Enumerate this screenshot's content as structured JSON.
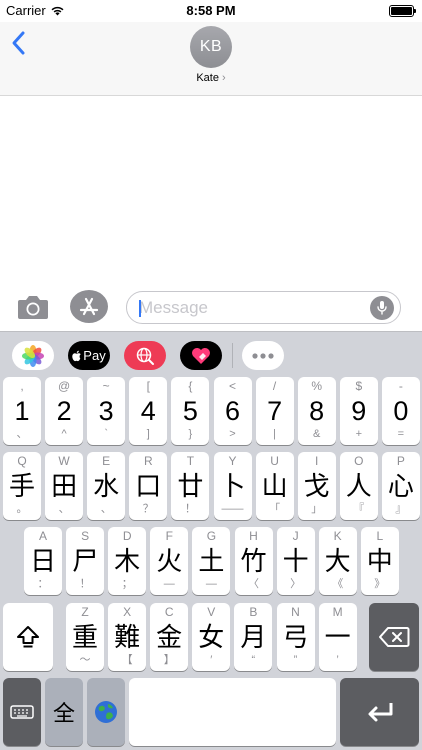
{
  "status": {
    "carrier": "Carrier",
    "time": "8:58 PM"
  },
  "header": {
    "avatar_initials": "KB",
    "contact_name": "Kate",
    "chevron": "›"
  },
  "compose": {
    "placeholder": "Message"
  },
  "app_drawer": {
    "apps": [
      {
        "name": "photos-app-icon"
      },
      {
        "name": "apple-pay-app-icon",
        "label": "Pay"
      },
      {
        "name": "web-search-app-icon"
      },
      {
        "name": "digital-touch-app-icon"
      },
      {
        "name": "more-apps-icon"
      }
    ]
  },
  "keyboard": {
    "row1": [
      {
        "main": "1",
        "top": ",",
        "bot": "、"
      },
      {
        "main": "2",
        "top": "@",
        "bot": "^"
      },
      {
        "main": "3",
        "top": "~",
        "bot": "`"
      },
      {
        "main": "4",
        "top": "[",
        "bot": "]"
      },
      {
        "main": "5",
        "top": "{",
        "bot": "}"
      },
      {
        "main": "6",
        "top": "<",
        "bot": ">"
      },
      {
        "main": "7",
        "top": "/",
        "bot": "|"
      },
      {
        "main": "8",
        "top": "%",
        "bot": "&"
      },
      {
        "main": "9",
        "top": "$",
        "bot": "+"
      },
      {
        "main": "0",
        "top": "-",
        "bot": "="
      }
    ],
    "row2": [
      {
        "main": "手",
        "top": "Q",
        "bot": "。"
      },
      {
        "main": "田",
        "top": "W",
        "bot": "、"
      },
      {
        "main": "水",
        "top": "E",
        "bot": "、"
      },
      {
        "main": "口",
        "top": "R",
        "bot": "？"
      },
      {
        "main": "廿",
        "top": "T",
        "bot": "！"
      },
      {
        "main": "卜",
        "top": "Y",
        "bot": "——"
      },
      {
        "main": "山",
        "top": "U",
        "bot": "「"
      },
      {
        "main": "戈",
        "top": "I",
        "bot": "」"
      },
      {
        "main": "人",
        "top": "O",
        "bot": "『"
      },
      {
        "main": "心",
        "top": "P",
        "bot": "』"
      }
    ],
    "row3": [
      {
        "main": "日",
        "top": "A",
        "bot": "："
      },
      {
        "main": "尸",
        "top": "S",
        "bot": "！"
      },
      {
        "main": "木",
        "top": "D",
        "bot": "；"
      },
      {
        "main": "火",
        "top": "F",
        "bot": "—"
      },
      {
        "main": "土",
        "top": "G",
        "bot": "—"
      },
      {
        "main": "竹",
        "top": "H",
        "bot": "〈"
      },
      {
        "main": "十",
        "top": "J",
        "bot": "〉"
      },
      {
        "main": "大",
        "top": "K",
        "bot": "《"
      },
      {
        "main": "中",
        "top": "L",
        "bot": "》"
      }
    ],
    "row4": [
      {
        "main": "重",
        "top": "Z",
        "bot": "～"
      },
      {
        "main": "難",
        "top": "X",
        "bot": "【"
      },
      {
        "main": "金",
        "top": "C",
        "bot": "】"
      },
      {
        "main": "女",
        "top": "V",
        "bot": "′"
      },
      {
        "main": "月",
        "top": "B",
        "bot": "“"
      },
      {
        "main": "弓",
        "top": "N",
        "bot": "”"
      },
      {
        "main": "一",
        "top": "M",
        "bot": "’"
      }
    ],
    "width_toggle_label": "全"
  },
  "colors": {
    "accent": "#3478f6",
    "keyboard_bg": "#d1d3d9",
    "function_key": "#abb0ba"
  }
}
